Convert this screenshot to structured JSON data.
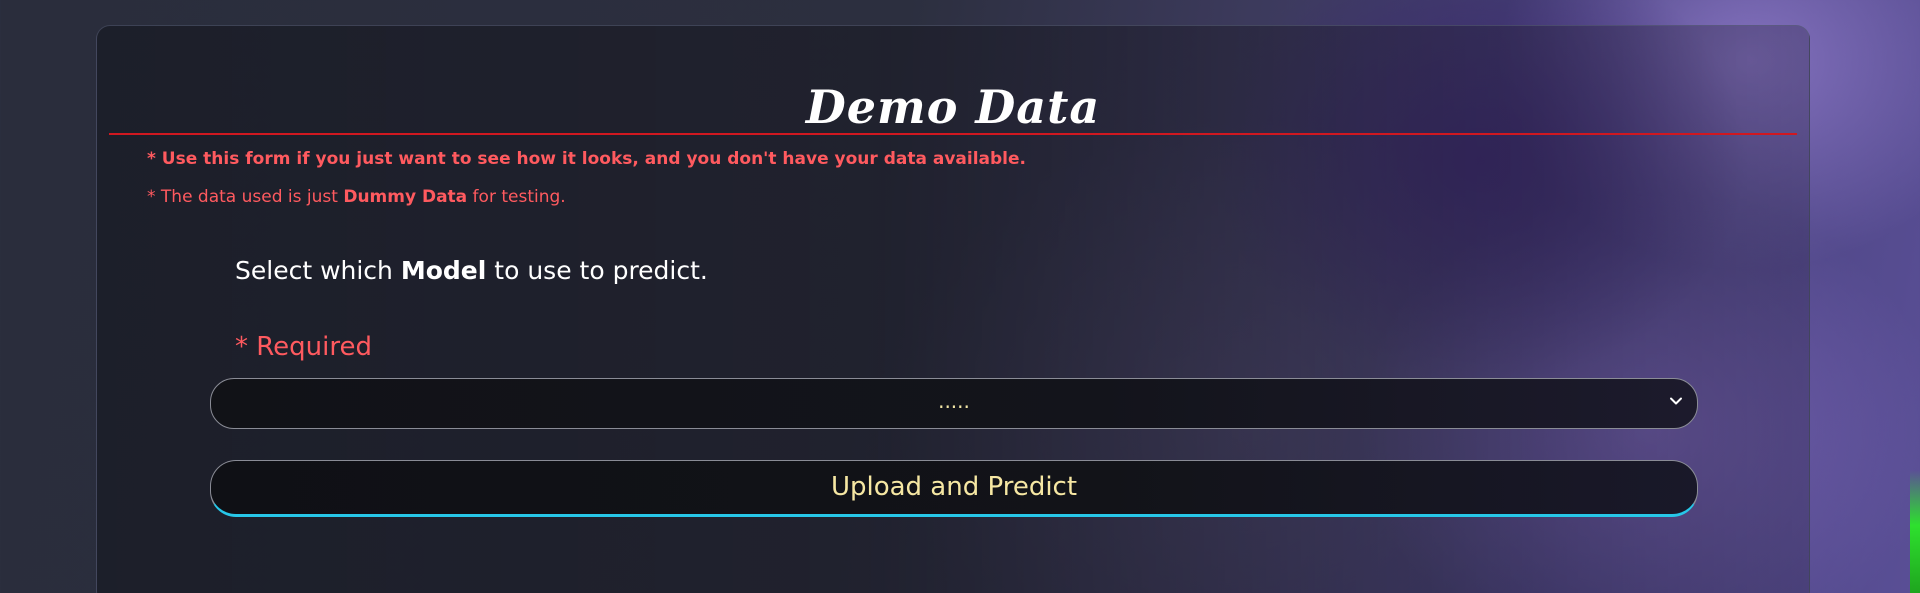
{
  "card": {
    "title": "Demo Data",
    "note_1": "* Use this form if you just want to see how it looks, and you don't have your data available.",
    "note_2_prefix": "* The data used is just ",
    "note_2_strong": "Dummy Data",
    "note_2_suffix": " for testing."
  },
  "form": {
    "prompt_prefix": "Select which ",
    "prompt_strong": "Model",
    "prompt_suffix": " to use to predict.",
    "required_label": "* Required",
    "model_select": {
      "selected_value": "....."
    },
    "submit_label": "Upload and Predict"
  },
  "icons": {
    "select_arrow": "chevron-down-icon"
  },
  "colors": {
    "accent_red": "#ff5a5f",
    "rule_red": "#d01820",
    "button_text": "#f6e7a3",
    "button_underline": "#27c7e8"
  }
}
